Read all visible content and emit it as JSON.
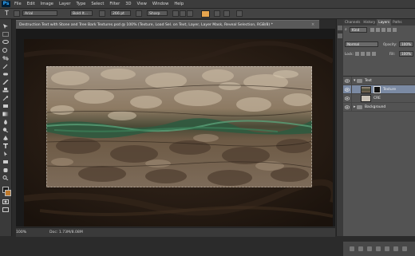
{
  "app": {
    "logo": "Ps"
  },
  "menu": [
    "File",
    "Edit",
    "Image",
    "Layer",
    "Type",
    "Select",
    "Filter",
    "3D",
    "View",
    "Window",
    "Help"
  ],
  "options": {
    "tool_icon": "T",
    "font_family": "Arial",
    "font_style": "Bold It...",
    "font_size": "266 pt",
    "antialias": "Sharp",
    "text_color": "#e5a44e"
  },
  "document": {
    "title": "Destruction Text with Stone and Tree Bark Textures.psd @ 100% (Texture, Load Sel. on Text, Layer, Layer Mask, Reveal Selection, RGB/8) *",
    "close_label": "×",
    "zoom": "100%",
    "info": "Doc: 1.73M/8.08M"
  },
  "panel": {
    "tabs": [
      "Channels",
      "History",
      "Layers",
      "Paths"
    ],
    "active_tab": "Layers",
    "filter_label": "Kind",
    "blend_mode": "Normal",
    "opacity_label": "Opacity:",
    "opacity": "100%",
    "lock_label": "Lock:",
    "fill_label": "Fill:",
    "fill": "100%"
  },
  "layers": [
    {
      "name": "Text",
      "type": "group",
      "expanded": true
    },
    {
      "name": "Texture",
      "type": "layer",
      "selected": true
    },
    {
      "name": "CRE",
      "type": "layer"
    },
    {
      "name": "Background",
      "type": "group",
      "expanded": false
    }
  ]
}
